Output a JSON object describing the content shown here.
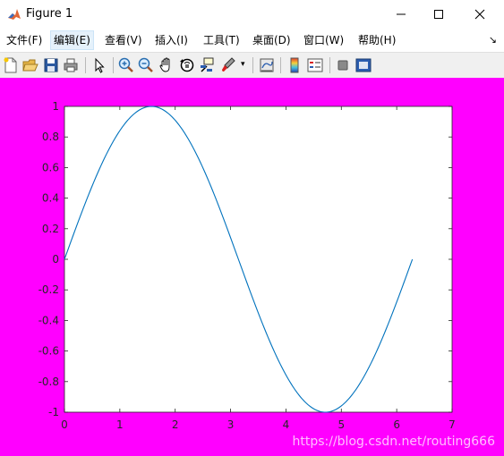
{
  "window": {
    "title": "Figure 1"
  },
  "menu": [
    "文件(F)",
    "编辑(E)",
    "查看(V)",
    "插入(I)",
    "工具(T)",
    "桌面(D)",
    "窗口(W)",
    "帮助(H)"
  ],
  "toolbar": [
    "new-figure",
    "open-file",
    "save",
    "print",
    "select-arrow",
    "zoom-in",
    "zoom-out",
    "pan-hand",
    "rotate-3d",
    "data-cursor",
    "brush",
    "link-plot",
    "insert-colorbar",
    "insert-legend",
    "hide-plot-tools",
    "show-plot-tools"
  ],
  "colors": {
    "figure_bg": "#ff00ff",
    "axes_bg": "#ffffff",
    "line": "#0072bd"
  },
  "chart_data": {
    "type": "line",
    "title": "",
    "xlabel": "",
    "ylabel": "",
    "xlim": [
      0,
      7
    ],
    "ylim": [
      -1,
      1
    ],
    "xticks": [
      "0",
      "1",
      "2",
      "3",
      "4",
      "5",
      "6",
      "7"
    ],
    "yticks": [
      "1",
      "0.8",
      "0.6",
      "0.4",
      "0.2",
      "0",
      "-0.2",
      "-0.4",
      "-0.6",
      "-0.8",
      "-1"
    ],
    "grid": false,
    "series": [
      {
        "function": "sin(x)",
        "x": [
          0,
          0.3142,
          0.6283,
          0.9425,
          1.2566,
          1.5708,
          1.885,
          2.1991,
          2.5133,
          2.8274,
          3.1416,
          3.4558,
          3.7699,
          4.0841,
          4.3982,
          4.7124,
          5.0265,
          5.3407,
          5.6549,
          5.969,
          6.2832
        ],
        "y": [
          0,
          0.309,
          0.5878,
          0.809,
          0.9511,
          1,
          0.9511,
          0.809,
          0.5878,
          0.309,
          0,
          -0.309,
          -0.5878,
          -0.809,
          -0.9511,
          -1,
          -0.9511,
          -0.809,
          -0.5878,
          -0.309,
          0
        ]
      }
    ]
  },
  "watermark": "https://blog.csdn.net/routing666"
}
